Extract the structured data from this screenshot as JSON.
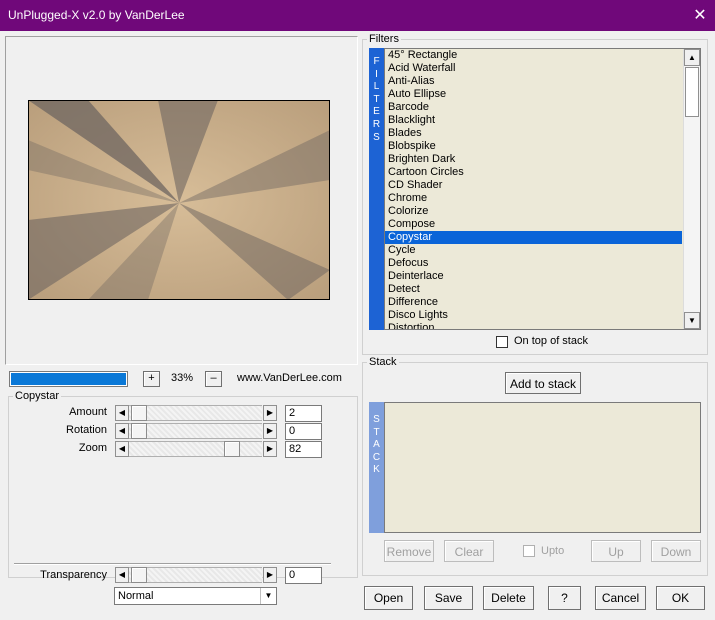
{
  "window": {
    "title": "UnPlugged-X v2.0 by VanDerLee",
    "close_icon": "close-icon"
  },
  "preview": {
    "zoom_value": "33%",
    "zoom_in": "+",
    "zoom_out": "–",
    "website": "www.VanDerLee.com"
  },
  "filters": {
    "group_label": "Filters",
    "bar_letters": [
      "F",
      "I",
      "L",
      "T",
      "E",
      "R",
      "S"
    ],
    "items": [
      "45° Rectangle",
      "Acid Waterfall",
      "Anti-Alias",
      "Auto Ellipse",
      "Barcode",
      "Blacklight",
      "Blades",
      "Blobspike",
      "Brighten Dark",
      "Cartoon Circles",
      "CD Shader",
      "Chrome",
      "Colorize",
      "Compose",
      "Copystar",
      "Cycle",
      "Defocus",
      "Deinterlace",
      "Detect",
      "Difference",
      "Disco Lights",
      "Distortion"
    ],
    "selected": "Copystar",
    "on_top_of_stack": "On top of stack"
  },
  "params": {
    "group_label": "Copystar",
    "amount": {
      "label": "Amount",
      "value": "2",
      "level": 0.0
    },
    "rotation": {
      "label": "Rotation",
      "value": "0",
      "level": 0.0
    },
    "zoom": {
      "label": "Zoom",
      "value": "82",
      "level": 0.82
    },
    "transparency": {
      "label": "Transparency",
      "value": "0",
      "level": 0.0
    },
    "blend_mode": "Normal"
  },
  "stack": {
    "group_label": "Stack",
    "add_button": "Add to stack",
    "bar_letters": [
      "S",
      "T",
      "A",
      "C",
      "K"
    ],
    "remove": "Remove",
    "clear": "Clear",
    "upto": "Upto",
    "up": "Up",
    "down": "Down"
  },
  "footer": {
    "open": "Open",
    "save": "Save",
    "delete": "Delete",
    "help": "?",
    "cancel": "Cancel",
    "ok": "OK"
  },
  "colors": {
    "titlebar": "#70087a",
    "accent_blue": "#1d63d4",
    "list_bg": "#ece9d8",
    "selection": "#0a64d8"
  }
}
